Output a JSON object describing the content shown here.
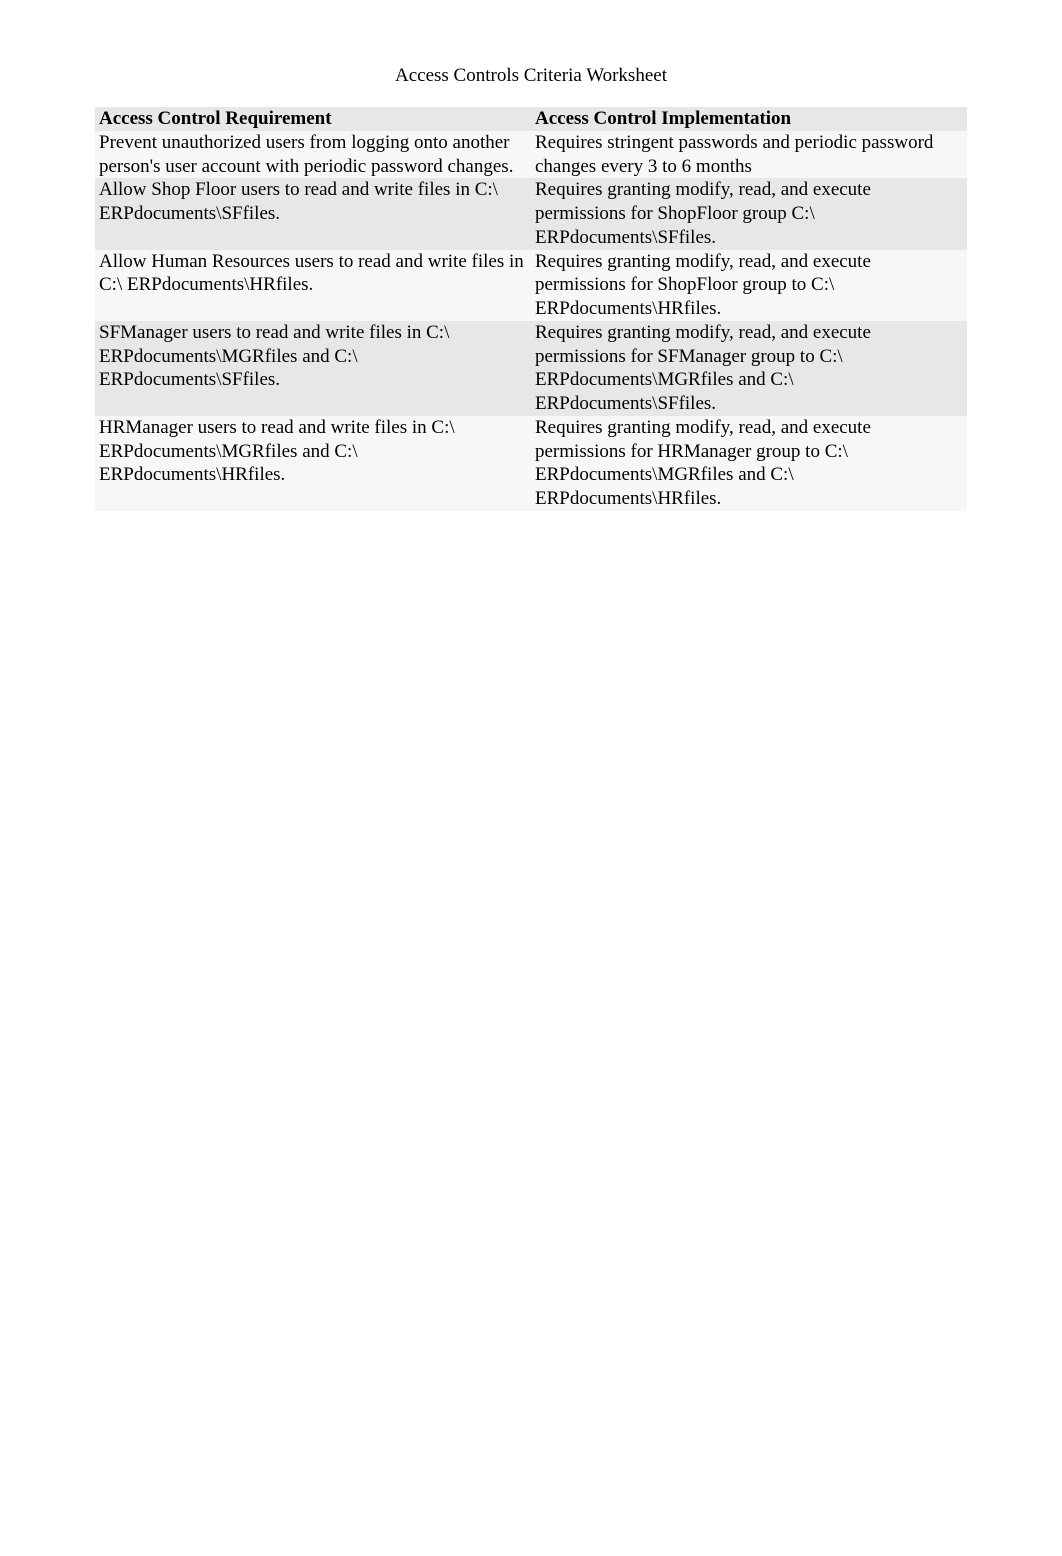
{
  "title": "Access Controls Criteria Worksheet",
  "headers": {
    "left": "Access Control Requirement",
    "right": "Access Control Implementation"
  },
  "rows": [
    {
      "requirement": "Prevent unauthorized users from logging onto another person's user account with periodic password changes.",
      "implementation": "Requires stringent passwords and periodic password changes every 3 to 6 months"
    },
    {
      "requirement": "Allow Shop Floor users to read and write files in C:\\ ERPdocuments\\SFfiles.",
      "implementation": "Requires granting modify, read, and execute permissions for ShopFloor group C:\\ ERPdocuments\\SFfiles."
    },
    {
      "requirement": "Allow Human Resources users to read and write files in C:\\ ERPdocuments\\HRfiles.",
      "implementation": "Requires granting modify, read, and execute permissions for ShopFloor group to C:\\ ERPdocuments\\HRfiles."
    },
    {
      "requirement": "SFManager users to read and write files in C:\\ ERPdocuments\\MGRfiles and C:\\ ERPdocuments\\SFfiles.",
      "implementation": "Requires granting modify, read, and execute permissions for SFManager group to C:\\ ERPdocuments\\MGRfiles and C:\\ ERPdocuments\\SFfiles."
    },
    {
      "requirement": "HRManager users to read and write files in C:\\ ERPdocuments\\MGRfiles and C:\\ ERPdocuments\\HRfiles.",
      "implementation": "Requires granting modify, read, and execute permissions for HRManager group to C:\\ ERPdocuments\\MGRfiles and C:\\ ERPdocuments\\HRfiles."
    }
  ]
}
